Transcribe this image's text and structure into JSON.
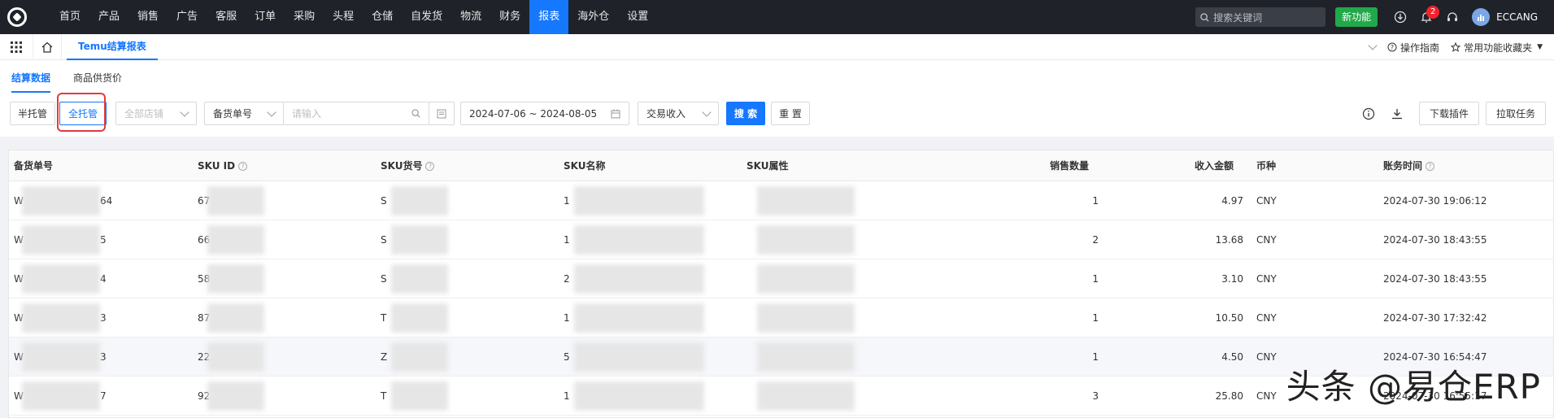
{
  "topnav": {
    "menu": [
      "首页",
      "产品",
      "销售",
      "广告",
      "客服",
      "订单",
      "采购",
      "头程",
      "仓储",
      "自发货",
      "物流",
      "财务",
      "报表",
      "海外仓",
      "设置"
    ],
    "active_index": 12,
    "search_placeholder": "搜索关键词",
    "new_feature": "新功能",
    "notification_count": "2",
    "username": "ECCANG"
  },
  "tabbar": {
    "active_tab": "Temu结算报表",
    "guide": "操作指南",
    "favorites": "常用功能收藏夹"
  },
  "subtabs": [
    "结算数据",
    "商品供货价"
  ],
  "filters": {
    "btn_half": "半托管",
    "btn_full": "全托管",
    "store_placeholder": "全部店铺",
    "order_type": "备货单号",
    "order_placeholder": "请输入",
    "date_range": "2024-07-06 ~ 2024-08-05",
    "income_type": "交易收入",
    "search": "搜 索",
    "reset": "重 置",
    "download_plugin": "下载插件",
    "pull_task": "拉取任务"
  },
  "table": {
    "headers": [
      "备货单号",
      "SKU ID",
      "SKU货号",
      "SKU名称",
      "SKU属性",
      "销售数量",
      "收入金额",
      "币种",
      "账务时间"
    ],
    "rows": [
      {
        "order": "W",
        "order_tail": "64",
        "skuid": "67",
        "skucode": "S",
        "skuname": "1",
        "qty": "1",
        "amount": "4.97",
        "currency": "CNY",
        "time": "2024-07-30 19:06:12"
      },
      {
        "order": "W",
        "order_tail": "5",
        "skuid": "66",
        "skucode": "S",
        "skuname": "1",
        "qty": "2",
        "amount": "13.68",
        "currency": "CNY",
        "time": "2024-07-30 18:43:55"
      },
      {
        "order": "W",
        "order_tail": "4",
        "skuid": "58",
        "skucode": "S",
        "skuname": "2",
        "qty": "1",
        "amount": "3.10",
        "currency": "CNY",
        "time": "2024-07-30 18:43:55"
      },
      {
        "order": "W",
        "order_tail": "3",
        "skuid": "87",
        "skucode": "T",
        "skuname": "1",
        "qty": "1",
        "amount": "10.50",
        "currency": "CNY",
        "time": "2024-07-30 17:32:42"
      },
      {
        "order": "W",
        "order_tail": "3",
        "skuid": "22",
        "skucode": "Z",
        "skuname": "5",
        "qty": "1",
        "amount": "4.50",
        "currency": "CNY",
        "time": "2024-07-30 16:54:47"
      },
      {
        "order": "W",
        "order_tail": "7",
        "skuid": "92",
        "skucode": "T",
        "skuname": "1",
        "qty": "3",
        "amount": "25.80",
        "currency": "CNY",
        "time": "2024-07-30 16:55:17"
      }
    ]
  },
  "watermark": "头条 @易仓ERP",
  "colors": {
    "nav_bg": "#1f2329",
    "accent": "#1677ff",
    "new_feature": "#21a84a",
    "highlight": "#e03c3c"
  }
}
